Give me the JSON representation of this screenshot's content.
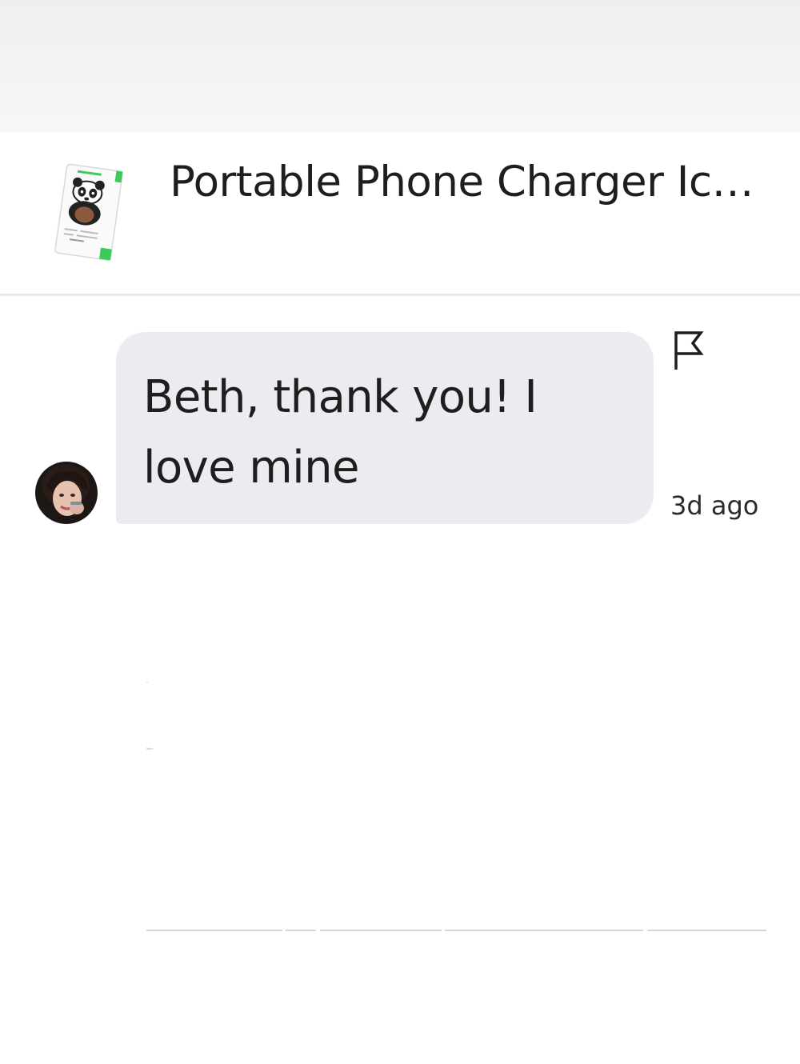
{
  "product": {
    "title": "Portable Phone Charger Ic…",
    "thumbnail_icon": "panda-charger-card-image"
  },
  "message": {
    "text": "Beth, thank you! I love mine",
    "timestamp": "3d ago",
    "avatar_icon": "user-avatar",
    "flag_icon": "flag-icon"
  },
  "colors": {
    "bubble": "#ebecf0",
    "divider": "#e9e9e9",
    "accent_green": "#3ccb5a"
  }
}
